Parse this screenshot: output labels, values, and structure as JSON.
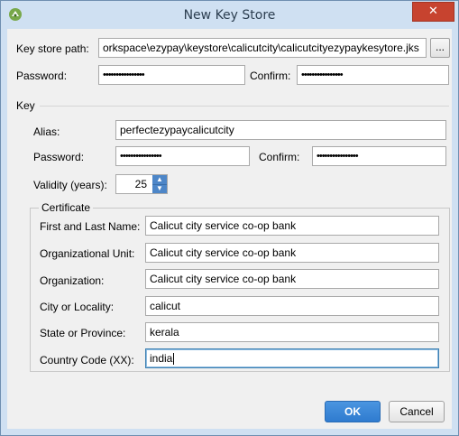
{
  "window": {
    "title": "New Key Store",
    "close_glyph": "✕",
    "icon": "android-studio-icon"
  },
  "keystore": {
    "path_label": "Key store path:",
    "path_value": "orkspace\\ezypay\\keystore\\calicutcity\\calicutcityezypaykesytore.jks",
    "browse_label": "...",
    "password_label": "Password:",
    "password_value": "••••••••••••••••",
    "confirm_label": "Confirm:",
    "confirm_value": "••••••••••••••••"
  },
  "key": {
    "section_label": "Key",
    "alias_label": "Alias:",
    "alias_value": "perfectezypaycalicutcity",
    "password_label": "Password:",
    "password_value": "••••••••••••••••",
    "confirm_label": "Confirm:",
    "confirm_value": "••••••••••••••••",
    "validity_label": "Validity (years):",
    "validity_value": "25"
  },
  "certificate": {
    "section_label": "Certificate",
    "fields": [
      {
        "label": "First and Last Name:",
        "value": "Calicut city service co-op bank"
      },
      {
        "label": "Organizational Unit:",
        "value": "Calicut city service co-op bank"
      },
      {
        "label": "Organization:",
        "value": "Calicut city service co-op bank"
      },
      {
        "label": "City or Locality:",
        "value": "calicut"
      },
      {
        "label": "State or Province:",
        "value": "kerala"
      },
      {
        "label": "Country Code (XX):",
        "value": "india"
      }
    ]
  },
  "buttons": {
    "ok": "OK",
    "cancel": "Cancel"
  },
  "colors": {
    "accent": "#2f7bcf",
    "titlebar": "#cfe0f2",
    "close": "#c7432f"
  }
}
